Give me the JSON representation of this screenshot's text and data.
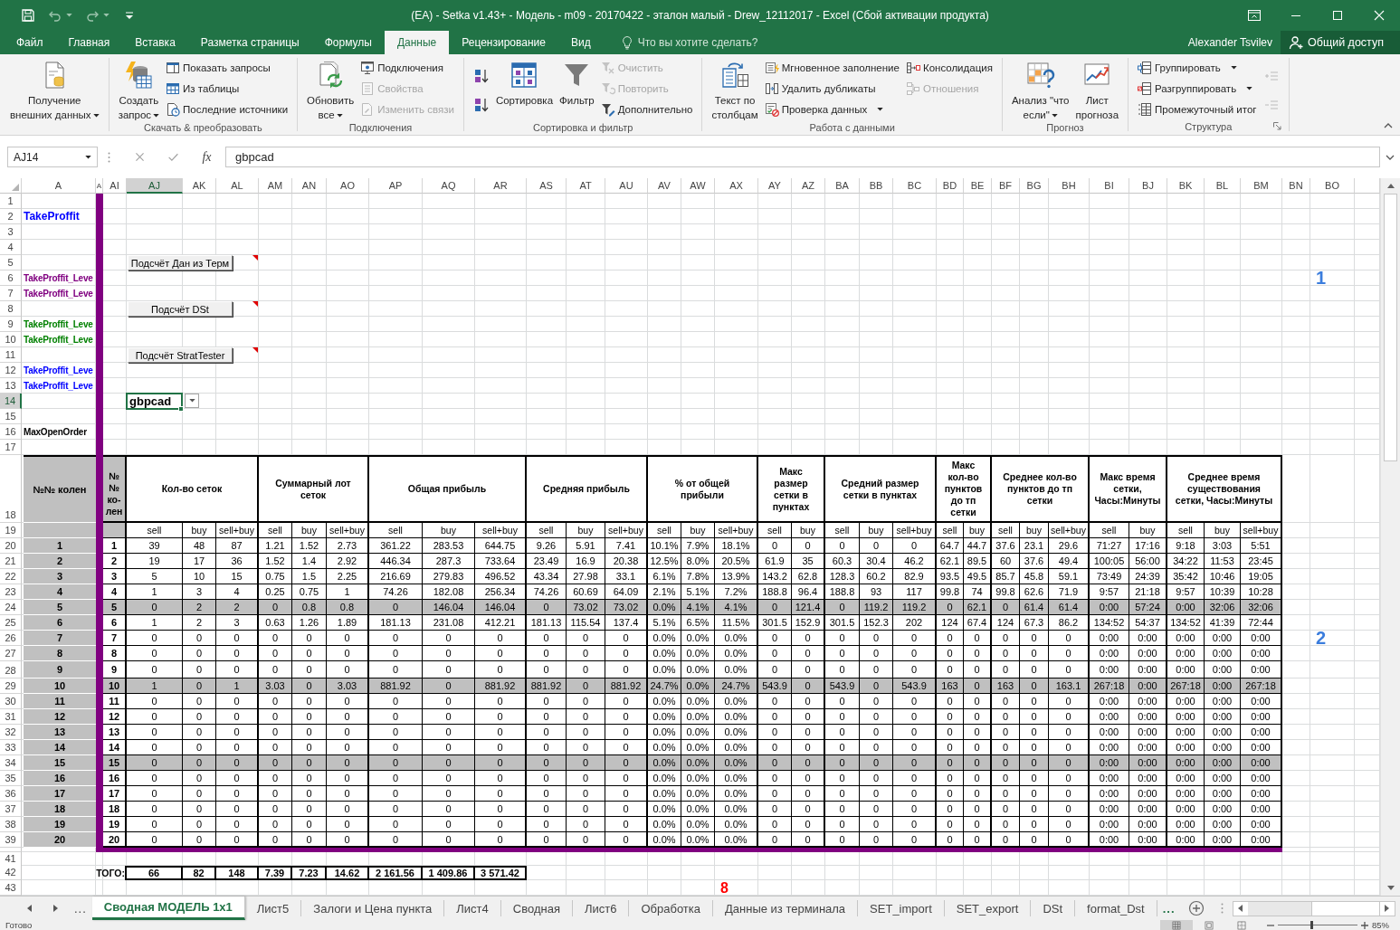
{
  "window": {
    "title": "(EA) - Setka v1.43+ - Модель - m09 - 20170422 - эталон малый - Drew_12112017 - Excel (Сбой активации продукта)",
    "user": "Alexander Tsvilev",
    "share_button": "Общий доступ"
  },
  "ribbon_tabs": [
    {
      "label": "Файл",
      "selected": false
    },
    {
      "label": "Главная",
      "selected": false
    },
    {
      "label": "Вставка",
      "selected": false
    },
    {
      "label": "Разметка страницы",
      "selected": false
    },
    {
      "label": "Формулы",
      "selected": false
    },
    {
      "label": "Данные",
      "selected": true
    },
    {
      "label": "Рецензирование",
      "selected": false
    },
    {
      "label": "Вид",
      "selected": false
    }
  ],
  "tell_me": {
    "placeholder": "Что вы хотите сделать?"
  },
  "ribbon_groups": [
    {
      "columns": [
        [
          {
            "kind": "large",
            "label": "Получение\nвнешних данных",
            "dropdown": true,
            "disabled": false
          }
        ]
      ]
    },
    {
      "label": "Скачать & преобразовать",
      "columns": [
        [
          {
            "kind": "large",
            "label": "Создать\nзапрос",
            "dropdown": true,
            "disabled": false
          }
        ],
        [
          {
            "kind": "small",
            "label": "Показать запросы",
            "dropdown": false,
            "disabled": false
          },
          {
            "kind": "small",
            "label": "Из таблицы",
            "dropdown": false,
            "disabled": false
          },
          {
            "kind": "small",
            "label": "Последние источники",
            "dropdown": false,
            "disabled": false
          }
        ]
      ]
    },
    {
      "label": "Подключения",
      "columns": [
        [
          {
            "kind": "large",
            "label": "Обновить\nвсе",
            "dropdown": true,
            "disabled": false
          }
        ],
        [
          {
            "kind": "small",
            "label": "Подключения",
            "dropdown": false,
            "disabled": false
          },
          {
            "kind": "small",
            "label": "Свойства",
            "dropdown": false,
            "disabled": true
          },
          {
            "kind": "small",
            "label": "Изменить связи",
            "dropdown": false,
            "disabled": true
          }
        ]
      ]
    },
    {
      "label": "Сортировка и фильтр",
      "columns": [
        [
          {
            "kind": "icon",
            "dropdown": false,
            "disabled": false
          },
          {
            "kind": "icon",
            "dropdown": false,
            "disabled": false
          }
        ],
        [
          {
            "kind": "large",
            "label": "Сортировка",
            "dropdown": false,
            "disabled": false
          }
        ],
        [
          {
            "kind": "large",
            "label": "Фильтр",
            "dropdown": false,
            "disabled": false
          }
        ],
        [
          {
            "kind": "small",
            "label": "Очистить",
            "dropdown": false,
            "disabled": true
          },
          {
            "kind": "small",
            "label": "Повторить",
            "dropdown": false,
            "disabled": true
          },
          {
            "kind": "small",
            "label": "Дополнительно",
            "dropdown": false,
            "disabled": false
          }
        ]
      ]
    },
    {
      "label": "Работа с данными",
      "columns": [
        [
          {
            "kind": "large",
            "label": "Текст по\nстолбцам",
            "dropdown": false,
            "disabled": false
          }
        ],
        [
          {
            "kind": "small",
            "label": "Мгновенное заполнение",
            "dropdown": false,
            "disabled": false
          },
          {
            "kind": "small",
            "label": "Удалить дубликаты",
            "dropdown": false,
            "disabled": false
          },
          {
            "kind": "small",
            "label": "Проверка данных",
            "dropdown": true,
            "disabled": false
          }
        ],
        [
          {
            "kind": "small",
            "label": "Консолидация",
            "dropdown": false,
            "disabled": false
          },
          {
            "kind": "small",
            "label": "Отношения",
            "dropdown": false,
            "disabled": true
          }
        ]
      ]
    },
    {
      "label": "Прогноз",
      "columns": [
        [
          {
            "kind": "large",
            "label": "Анализ \"что\nесли\"",
            "dropdown": true,
            "disabled": false
          }
        ],
        [
          {
            "kind": "large",
            "label": "Лист\nпрогноза",
            "dropdown": false,
            "disabled": false
          }
        ]
      ]
    },
    {
      "label": "Структура",
      "launcher": true,
      "columns": [
        [
          {
            "kind": "small",
            "label": "Группировать",
            "dropdown": true,
            "disabled": false
          },
          {
            "kind": "small",
            "label": "Разгруппировать",
            "dropdown": true,
            "disabled": false
          },
          {
            "kind": "small",
            "label": "Промежуточный итог",
            "dropdown": false,
            "disabled": false
          }
        ],
        [
          {
            "kind": "icon",
            "dropdown": false,
            "disabled": true
          },
          {
            "kind": "icon",
            "dropdown": false,
            "disabled": true
          }
        ]
      ]
    }
  ],
  "formula_bar": {
    "name_box": "AJ14",
    "function_label": "fx",
    "value": "gbpcad"
  },
  "sheet": {
    "column_headers": [
      {
        "label": "A",
        "selected": false
      },
      {
        "label": "A",
        "selected": false
      },
      {
        "label": "AI",
        "selected": false
      },
      {
        "label": "AJ",
        "selected": true
      },
      {
        "label": "AK",
        "selected": false
      },
      {
        "label": "AL",
        "selected": false
      },
      {
        "label": "AM",
        "selected": false
      },
      {
        "label": "AN",
        "selected": false
      },
      {
        "label": "AO",
        "selected": false
      },
      {
        "label": "AP",
        "selected": false
      },
      {
        "label": "AQ",
        "selected": false
      },
      {
        "label": "AR",
        "selected": false
      },
      {
        "label": "AS",
        "selected": false
      },
      {
        "label": "AT",
        "selected": false
      },
      {
        "label": "AU",
        "selected": false
      },
      {
        "label": "AV",
        "selected": false
      },
      {
        "label": "AW",
        "selected": false
      },
      {
        "label": "AX",
        "selected": false
      },
      {
        "label": "AY",
        "selected": false
      },
      {
        "label": "AZ",
        "selected": false
      },
      {
        "label": "BA",
        "selected": false
      },
      {
        "label": "BB",
        "selected": false
      },
      {
        "label": "BC",
        "selected": false
      },
      {
        "label": "BD",
        "selected": false
      },
      {
        "label": "BE",
        "selected": false
      },
      {
        "label": "BF",
        "selected": false
      },
      {
        "label": "BG",
        "selected": false
      },
      {
        "label": "BH",
        "selected": false
      },
      {
        "label": "BI",
        "selected": false
      },
      {
        "label": "BJ",
        "selected": false
      },
      {
        "label": "BK",
        "selected": false
      },
      {
        "label": "BL",
        "selected": false
      },
      {
        "label": "BM",
        "selected": false
      },
      {
        "label": "BN",
        "selected": false
      },
      {
        "label": "BO",
        "selected": false
      }
    ],
    "row_headers": [
      {
        "label": "1",
        "selected": false
      },
      {
        "label": "2",
        "selected": false
      },
      {
        "label": "3",
        "selected": false
      },
      {
        "label": "4",
        "selected": false
      },
      {
        "label": "5",
        "selected": false
      },
      {
        "label": "6",
        "selected": false
      },
      {
        "label": "7",
        "selected": false
      },
      {
        "label": "8",
        "selected": false
      },
      {
        "label": "9",
        "selected": false
      },
      {
        "label": "10",
        "selected": false
      },
      {
        "label": "11",
        "selected": false
      },
      {
        "label": "12",
        "selected": false
      },
      {
        "label": "13",
        "selected": false
      },
      {
        "label": "14",
        "selected": true
      },
      {
        "label": "15",
        "selected": false
      },
      {
        "label": "16",
        "selected": false
      },
      {
        "label": "17",
        "selected": false
      },
      {
        "label": "18",
        "selected": false
      },
      {
        "label": "19",
        "selected": false
      },
      {
        "label": "20",
        "selected": false
      },
      {
        "label": "21",
        "selected": false
      },
      {
        "label": "22",
        "selected": false
      },
      {
        "label": "23",
        "selected": false
      },
      {
        "label": "24",
        "selected": false
      },
      {
        "label": "25",
        "selected": false
      },
      {
        "label": "26",
        "selected": false
      },
      {
        "label": "27",
        "selected": false
      },
      {
        "label": "28",
        "selected": false
      },
      {
        "label": "29",
        "selected": false
      },
      {
        "label": "30",
        "selected": false
      },
      {
        "label": "31",
        "selected": false
      },
      {
        "label": "32",
        "selected": false
      },
      {
        "label": "33",
        "selected": false
      },
      {
        "label": "34",
        "selected": false
      },
      {
        "label": "35",
        "selected": false
      },
      {
        "label": "36",
        "selected": false
      },
      {
        "label": "37",
        "selected": false
      },
      {
        "label": "38",
        "selected": false
      },
      {
        "label": "39",
        "selected": false
      },
      {
        "label": "41",
        "selected": false
      },
      {
        "label": "42",
        "selected": false
      },
      {
        "label": "43",
        "selected": false
      }
    ],
    "labels": [
      {
        "text": "TakeProffit",
        "color": "#0000ff"
      },
      {
        "text": "TakeProffit_Leve",
        "color": "#800080"
      },
      {
        "text": "TakeProffit_Leve",
        "color": "#800080"
      },
      {
        "text": "TakeProffit_Leve",
        "color": "#008000"
      },
      {
        "text": "TakeProffit_Leve",
        "color": "#008000"
      },
      {
        "text": "TakeProffit_Leve",
        "color": "#0000ff"
      },
      {
        "text": "TakeProffit_Leve",
        "color": "#0000ff"
      },
      {
        "text": "MaxOpenOrder",
        "color": "#000000"
      }
    ],
    "macro_buttons": [
      {
        "label": "Подсчёт Дан из Терм",
        "comment": true
      },
      {
        "label": "Подсчёт DSt",
        "comment": true
      },
      {
        "label": "Подсчёт StratTester",
        "comment": true
      }
    ],
    "active_cell": {
      "value": "gbpcad"
    },
    "markers": [
      {
        "text": "1",
        "color": "#3b7ddd"
      },
      {
        "text": "2",
        "color": "#3b7ddd"
      },
      {
        "text": "8",
        "color": "#ff0000"
      }
    ],
    "summary_table": {
      "row_label_header": "№№ колен",
      "index_header": "№\n№\nко-\nлен",
      "groups": [
        {
          "title": "Кол-во сеток",
          "columns": [
            "sell",
            "buy",
            "sell+buy"
          ]
        },
        {
          "title": "Суммарный лот сеток",
          "columns": [
            "sell",
            "buy",
            "sell+buy"
          ]
        },
        {
          "title": "Общая прибыль",
          "columns": [
            "sell",
            "buy",
            "sell+buy"
          ]
        },
        {
          "title": "Средняя прибыль",
          "columns": [
            "sell",
            "buy",
            "sell+buy"
          ]
        },
        {
          "title": "% от общей прибыли",
          "columns": [
            "sell",
            "buy",
            "sell+buy"
          ]
        },
        {
          "title": "Макс размер сетки в пунктах",
          "columns": [
            "sell",
            "buy"
          ]
        },
        {
          "title": "Средний размер сетки в пунктах",
          "columns": [
            "sell",
            "buy",
            "sell+buy"
          ]
        },
        {
          "title": "Макс кол-во пунктов до тп сетки",
          "columns": [
            "sell",
            "buy"
          ]
        },
        {
          "title": "Среднее кол-во пунктов до тп сетки",
          "columns": [
            "sell",
            "buy",
            "sell+buy"
          ]
        },
        {
          "title": "Макс время сетки, Часы:Минуты",
          "columns": [
            "sell",
            "buy"
          ]
        },
        {
          "title": "Среднее время существования сетки, Часы:Минуты",
          "columns": [
            "sell",
            "buy",
            "sell+buy"
          ]
        }
      ],
      "rows": [
        {
          "label": "1",
          "index": "1",
          "highlighted": false,
          "values": [
            "39",
            "48",
            "87",
            "1.21",
            "1.52",
            "2.73",
            "361.22",
            "283.53",
            "644.75",
            "9.26",
            "5.91",
            "7.41",
            "10.1%",
            "7.9%",
            "18.1%",
            "0",
            "0",
            "0",
            "0",
            "0",
            "64.7",
            "44.7",
            "37.6",
            "23.1",
            "29.6",
            "71:27",
            "17:16",
            "9:18",
            "3:03",
            "5:51"
          ]
        },
        {
          "label": "2",
          "index": "2",
          "highlighted": false,
          "values": [
            "19",
            "17",
            "36",
            "1.52",
            "1.4",
            "2.92",
            "446.34",
            "287.3",
            "733.64",
            "23.49",
            "16.9",
            "20.38",
            "12.5%",
            "8.0%",
            "20.5%",
            "61.9",
            "35",
            "60.3",
            "30.4",
            "46.2",
            "62.1",
            "89.5",
            "60",
            "37.6",
            "49.4",
            "100:05",
            "56:00",
            "34:22",
            "11:53",
            "23:45"
          ]
        },
        {
          "label": "3",
          "index": "3",
          "highlighted": false,
          "values": [
            "5",
            "10",
            "15",
            "0.75",
            "1.5",
            "2.25",
            "216.69",
            "279.83",
            "496.52",
            "43.34",
            "27.98",
            "33.1",
            "6.1%",
            "7.8%",
            "13.9%",
            "143.2",
            "62.8",
            "128.3",
            "60.2",
            "82.9",
            "93.5",
            "49.5",
            "85.7",
            "45.8",
            "59.1",
            "73:49",
            "24:39",
            "35:42",
            "10:46",
            "19:05"
          ]
        },
        {
          "label": "4",
          "index": "4",
          "highlighted": false,
          "values": [
            "1",
            "3",
            "4",
            "0.25",
            "0.75",
            "1",
            "74.26",
            "182.08",
            "256.34",
            "74.26",
            "60.69",
            "64.09",
            "2.1%",
            "5.1%",
            "7.2%",
            "188.8",
            "96.4",
            "188.8",
            "93",
            "117",
            "99.8",
            "74",
            "99.8",
            "62.6",
            "71.9",
            "9:57",
            "21:18",
            "9:57",
            "10:39",
            "10:28"
          ]
        },
        {
          "label": "5",
          "index": "5",
          "highlighted": true,
          "values": [
            "0",
            "2",
            "2",
            "0",
            "0.8",
            "0.8",
            "0",
            "146.04",
            "146.04",
            "0",
            "73.02",
            "73.02",
            "0.0%",
            "4.1%",
            "4.1%",
            "0",
            "121.4",
            "0",
            "119.2",
            "119.2",
            "0",
            "62.1",
            "0",
            "61.4",
            "61.4",
            "0:00",
            "57:24",
            "0:00",
            "32:06",
            "32:06"
          ]
        },
        {
          "label": "6",
          "index": "6",
          "highlighted": false,
          "values": [
            "1",
            "2",
            "3",
            "0.63",
            "1.26",
            "1.89",
            "181.13",
            "231.08",
            "412.21",
            "181.13",
            "115.54",
            "137.4",
            "5.1%",
            "6.5%",
            "11.5%",
            "301.5",
            "152.9",
            "301.5",
            "152.3",
            "202",
            "124",
            "67.4",
            "124",
            "67.3",
            "86.2",
            "134:52",
            "54:37",
            "134:52",
            "41:39",
            "72:44"
          ]
        },
        {
          "label": "7",
          "index": "7",
          "highlighted": false,
          "values": [
            "0",
            "0",
            "0",
            "0",
            "0",
            "0",
            "0",
            "0",
            "0",
            "0",
            "0",
            "0",
            "0.0%",
            "0.0%",
            "0.0%",
            "0",
            "0",
            "0",
            "0",
            "0",
            "0",
            "0",
            "0",
            "0",
            "0",
            "0:00",
            "0:00",
            "0:00",
            "0:00",
            "0:00"
          ]
        },
        {
          "label": "8",
          "index": "8",
          "highlighted": false,
          "values": [
            "0",
            "0",
            "0",
            "0",
            "0",
            "0",
            "0",
            "0",
            "0",
            "0",
            "0",
            "0",
            "0.0%",
            "0.0%",
            "0.0%",
            "0",
            "0",
            "0",
            "0",
            "0",
            "0",
            "0",
            "0",
            "0",
            "0",
            "0:00",
            "0:00",
            "0:00",
            "0:00",
            "0:00"
          ]
        },
        {
          "label": "9",
          "index": "9",
          "highlighted": false,
          "values": [
            "0",
            "0",
            "0",
            "0",
            "0",
            "0",
            "0",
            "0",
            "0",
            "0",
            "0",
            "0",
            "0.0%",
            "0.0%",
            "0.0%",
            "0",
            "0",
            "0",
            "0",
            "0",
            "0",
            "0",
            "0",
            "0",
            "0",
            "0:00",
            "0:00",
            "0:00",
            "0:00",
            "0:00"
          ]
        },
        {
          "label": "10",
          "index": "10",
          "highlighted": true,
          "values": [
            "1",
            "0",
            "1",
            "3.03",
            "0",
            "3.03",
            "881.92",
            "0",
            "881.92",
            "881.92",
            "0",
            "881.92",
            "24.7%",
            "0.0%",
            "24.7%",
            "543.9",
            "0",
            "543.9",
            "0",
            "543.9",
            "163",
            "0",
            "163",
            "0",
            "163.1",
            "267:18",
            "0:00",
            "267:18",
            "0:00",
            "267:18"
          ]
        },
        {
          "label": "11",
          "index": "11",
          "highlighted": false,
          "values": [
            "0",
            "0",
            "0",
            "0",
            "0",
            "0",
            "0",
            "0",
            "0",
            "0",
            "0",
            "0",
            "0.0%",
            "0.0%",
            "0.0%",
            "0",
            "0",
            "0",
            "0",
            "0",
            "0",
            "0",
            "0",
            "0",
            "0",
            "0:00",
            "0:00",
            "0:00",
            "0:00",
            "0:00"
          ]
        },
        {
          "label": "12",
          "index": "12",
          "highlighted": false,
          "values": [
            "0",
            "0",
            "0",
            "0",
            "0",
            "0",
            "0",
            "0",
            "0",
            "0",
            "0",
            "0",
            "0.0%",
            "0.0%",
            "0.0%",
            "0",
            "0",
            "0",
            "0",
            "0",
            "0",
            "0",
            "0",
            "0",
            "0",
            "0:00",
            "0:00",
            "0:00",
            "0:00",
            "0:00"
          ]
        },
        {
          "label": "13",
          "index": "13",
          "highlighted": false,
          "values": [
            "0",
            "0",
            "0",
            "0",
            "0",
            "0",
            "0",
            "0",
            "0",
            "0",
            "0",
            "0",
            "0.0%",
            "0.0%",
            "0.0%",
            "0",
            "0",
            "0",
            "0",
            "0",
            "0",
            "0",
            "0",
            "0",
            "0",
            "0:00",
            "0:00",
            "0:00",
            "0:00",
            "0:00"
          ]
        },
        {
          "label": "14",
          "index": "14",
          "highlighted": false,
          "values": [
            "0",
            "0",
            "0",
            "0",
            "0",
            "0",
            "0",
            "0",
            "0",
            "0",
            "0",
            "0",
            "0.0%",
            "0.0%",
            "0.0%",
            "0",
            "0",
            "0",
            "0",
            "0",
            "0",
            "0",
            "0",
            "0",
            "0",
            "0:00",
            "0:00",
            "0:00",
            "0:00",
            "0:00"
          ]
        },
        {
          "label": "15",
          "index": "15",
          "highlighted": true,
          "values": [
            "0",
            "0",
            "0",
            "0",
            "0",
            "0",
            "0",
            "0",
            "0",
            "0",
            "0",
            "0",
            "0.0%",
            "0.0%",
            "0.0%",
            "0",
            "0",
            "0",
            "0",
            "0",
            "0",
            "0",
            "0",
            "0",
            "0",
            "0:00",
            "0:00",
            "0:00",
            "0:00",
            "0:00"
          ]
        },
        {
          "label": "16",
          "index": "16",
          "highlighted": false,
          "values": [
            "0",
            "0",
            "0",
            "0",
            "0",
            "0",
            "0",
            "0",
            "0",
            "0",
            "0",
            "0",
            "0.0%",
            "0.0%",
            "0.0%",
            "0",
            "0",
            "0",
            "0",
            "0",
            "0",
            "0",
            "0",
            "0",
            "0",
            "0:00",
            "0:00",
            "0:00",
            "0:00",
            "0:00"
          ]
        },
        {
          "label": "17",
          "index": "17",
          "highlighted": false,
          "values": [
            "0",
            "0",
            "0",
            "0",
            "0",
            "0",
            "0",
            "0",
            "0",
            "0",
            "0",
            "0",
            "0.0%",
            "0.0%",
            "0.0%",
            "0",
            "0",
            "0",
            "0",
            "0",
            "0",
            "0",
            "0",
            "0",
            "0",
            "0:00",
            "0:00",
            "0:00",
            "0:00",
            "0:00"
          ]
        },
        {
          "label": "18",
          "index": "18",
          "highlighted": false,
          "values": [
            "0",
            "0",
            "0",
            "0",
            "0",
            "0",
            "0",
            "0",
            "0",
            "0",
            "0",
            "0",
            "0.0%",
            "0.0%",
            "0.0%",
            "0",
            "0",
            "0",
            "0",
            "0",
            "0",
            "0",
            "0",
            "0",
            "0",
            "0:00",
            "0:00",
            "0:00",
            "0:00",
            "0:00"
          ]
        },
        {
          "label": "19",
          "index": "19",
          "highlighted": false,
          "values": [
            "0",
            "0",
            "0",
            "0",
            "0",
            "0",
            "0",
            "0",
            "0",
            "0",
            "0",
            "0",
            "0.0%",
            "0.0%",
            "0.0%",
            "0",
            "0",
            "0",
            "0",
            "0",
            "0",
            "0",
            "0",
            "0",
            "0",
            "0:00",
            "0:00",
            "0:00",
            "0:00",
            "0:00"
          ]
        },
        {
          "label": "20",
          "index": "20",
          "highlighted": false,
          "values": [
            "0",
            "0",
            "0",
            "0",
            "0",
            "0",
            "0",
            "0",
            "0",
            "0",
            "0",
            "0",
            "0.0%",
            "0.0%",
            "0.0%",
            "0",
            "0",
            "0",
            "0",
            "0",
            "0",
            "0",
            "0",
            "0",
            "0",
            "0:00",
            "0:00",
            "0:00",
            "0:00",
            "0:00"
          ]
        }
      ],
      "total_label": "ТОГО:",
      "totals": [
        "66",
        "82",
        "148",
        "7.39",
        "7.23",
        "14.62",
        "2 161.56",
        "1 409.86",
        "3 571.42"
      ]
    }
  },
  "sheet_tabs": {
    "more_left": "...",
    "tabs": [
      {
        "label": "Сводная МОДЕЛЬ 1x1",
        "selected": true
      },
      {
        "label": "Лист5",
        "selected": false
      },
      {
        "label": "Залоги и Цена пункта",
        "selected": false
      },
      {
        "label": "Лист4",
        "selected": false
      },
      {
        "label": "Сводная",
        "selected": false
      },
      {
        "label": "Лист6",
        "selected": false
      },
      {
        "label": "Обработка",
        "selected": false
      },
      {
        "label": "Данные из терминала",
        "selected": false
      },
      {
        "label": "SET_import",
        "selected": false
      },
      {
        "label": "SET_export",
        "selected": false
      },
      {
        "label": "DSt",
        "selected": false
      },
      {
        "label": "format_Dst",
        "selected": false
      }
    ],
    "more_right": "..."
  },
  "status_bar": {
    "text": "Готово",
    "views": [
      {
        "selected": true
      },
      {
        "selected": false
      },
      {
        "selected": false
      }
    ],
    "zoom": {
      "level": 0.42,
      "reading": "85%"
    }
  }
}
